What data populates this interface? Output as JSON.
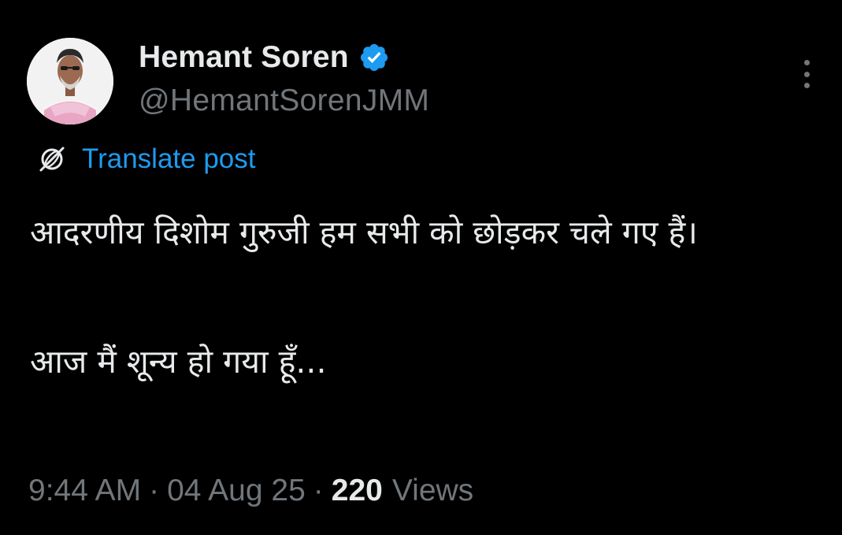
{
  "author": {
    "display_name": "Hemant Soren",
    "handle": "@HemantSorenJMM",
    "verified_badge_color": "#1d9bf0",
    "verified_icon": "verified-badge-icon",
    "avatar_icon": "profile-photo"
  },
  "menu": {
    "more_icon": "more-vertical-icon"
  },
  "translate": {
    "icon": "translate-globe-icon",
    "label": "Translate post"
  },
  "post": {
    "paragraphs": [
      "आदरणीय दिशोम गुरुजी हम सभी को छोड़कर चले गए हैं।",
      "आज मैं शून्य हो गया हूँ..."
    ]
  },
  "meta": {
    "time": "9:44 AM",
    "separator": "·",
    "date": "04 Aug 25",
    "views_count": "220",
    "views_label": "Views"
  },
  "colors": {
    "background": "#000000",
    "primary_text": "#e7e9ea",
    "secondary_text": "#71767b",
    "link": "#1d9bf0"
  }
}
